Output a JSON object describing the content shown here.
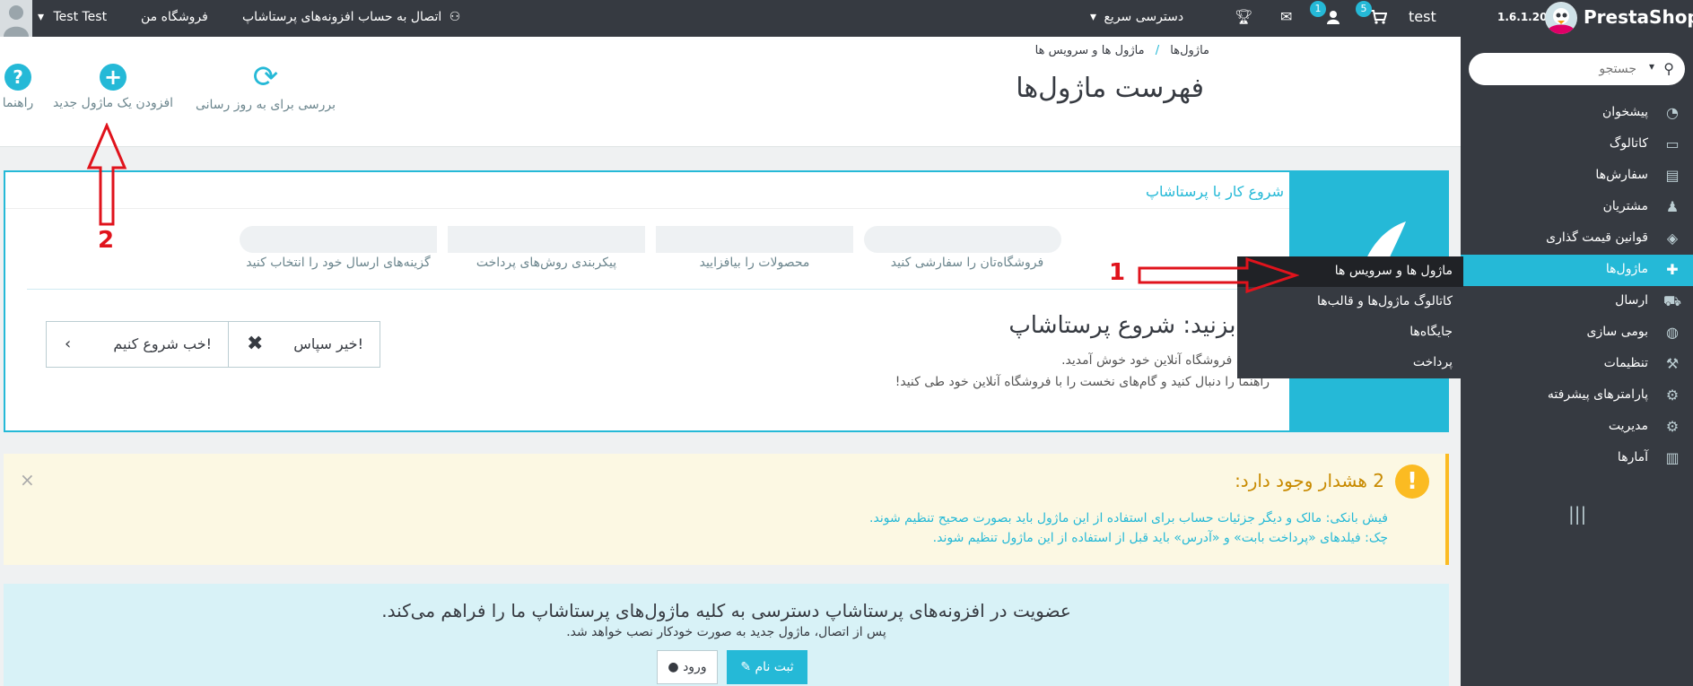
{
  "topbar": {
    "brand": "PrestaShop",
    "version": "1.6.1.20",
    "shop_name": "test",
    "cart_badge": "5",
    "user_badge": "1",
    "quick_access": "دسترسی سریع",
    "connect": "اتصال به حساب افزونه‌های پرستاشاپ",
    "my_shop": "فروشگاه من",
    "employee": "Test Test"
  },
  "search": {
    "placeholder": "جستجو"
  },
  "sidebar": {
    "items": [
      {
        "label": "پیشخوان",
        "icon": "dashboard-icon"
      },
      {
        "label": "کاتالوگ",
        "icon": "book-icon"
      },
      {
        "label": "سفارش‌ها",
        "icon": "credit-card-icon"
      },
      {
        "label": "مشتریان",
        "icon": "users-icon"
      },
      {
        "label": "قوانین قیمت گذاری",
        "icon": "tags-icon"
      },
      {
        "label": "ماژول‌ها",
        "icon": "puzzle-icon"
      },
      {
        "label": "ارسال",
        "icon": "truck-icon"
      },
      {
        "label": "بومی سازی",
        "icon": "globe-icon"
      },
      {
        "label": "تنظیمات",
        "icon": "wrench-icon"
      },
      {
        "label": "پارامترهای پیشرفته",
        "icon": "cogs-icon"
      },
      {
        "label": "مدیریت",
        "icon": "cog-icon"
      },
      {
        "label": "آمارها",
        "icon": "bar-chart-icon"
      }
    ],
    "submenu": [
      {
        "label": "ماژول ها و سرویس ها"
      },
      {
        "label": "کاتالوگ ماژول‌ها و قالب‌ها"
      },
      {
        "label": "جایگاه‌ها"
      },
      {
        "label": "پرداخت"
      }
    ]
  },
  "header": {
    "breadcrumb_parent": "ماژول‌ها",
    "breadcrumb_sep": "/",
    "breadcrumb_current": "ماژول ها و سرویس ها",
    "title": "فهرست ماژول‌ها",
    "toolbar": {
      "check_update": "بررسی برای به روز رسانی",
      "add_module": "افزودن یک ماژول جدید",
      "help": "راهنما"
    }
  },
  "onboarding": {
    "heading": "شروع کار با پرستاشاپ",
    "steps": [
      "فروشگاه‌تان را سفارشی کنید",
      "محصولات را بیافزایید",
      "پیکربندی روش‌های پرداخت",
      "گزینه‌های ارسال خود را انتخاب کنید"
    ],
    "title": "ستی بزنید: شروع پرستاشاپ",
    "line1": "ر Test، به فروشگاه آنلاین خود خوش آمدید.",
    "line2": "راهنما را دنبال کنید و گام‌های نخست را با فروشگاه آنلاین خود طی کنید!",
    "btn_no": "خیر سپاس!",
    "btn_start": "خب شروع کنیم!"
  },
  "warning": {
    "title": "2 هشدار وجود دارد:",
    "items": [
      "فیش بانکی: مالک و دیگر جزئیات حساب برای استفاده از این ماژول باید بصورت صحیح تنظیم شوند.",
      "چک: فیلدهای «پرداخت بابت» و «آدرس» باید قبل از استفاده از این ماژول تنظیم شوند."
    ]
  },
  "addons": {
    "title": "عضویت در افزونه‌های پرستاشاپ دسترسی به کلیه ماژول‌های پرستاشاپ ما را فراهم می‌کند.",
    "subtitle": "پس از اتصال، ماژول جدید به صورت خودکار نصب خواهد شد.",
    "register": "ثبت نام",
    "login": "ورود"
  },
  "annotations": {
    "one": "1",
    "two": "2"
  },
  "colors": {
    "accent": "#25b9d7",
    "dark": "#363a41",
    "warning_bg": "#fcf8e3",
    "warning": "#fbbb22",
    "arrow": "#e0131c"
  }
}
